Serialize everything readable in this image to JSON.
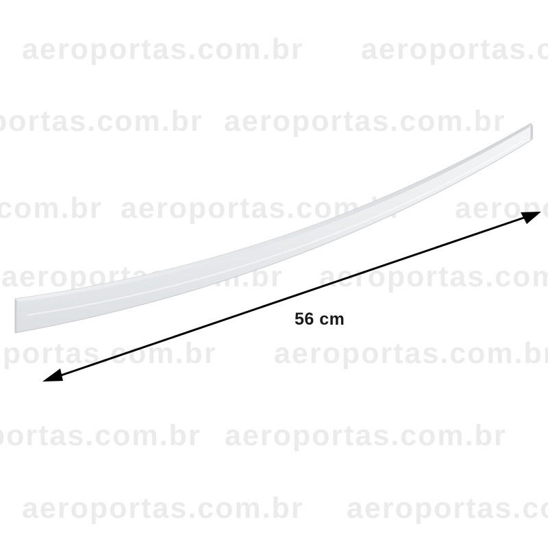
{
  "watermark": {
    "text": "aeroportas.com.br"
  },
  "dimension": {
    "label": "56 cm"
  },
  "colors": {
    "background": "#ffffff",
    "watermark": "#e8e8e8",
    "handle_light": "#f4f5f6",
    "handle_mid": "#dcdee0",
    "handle_edge": "#b9bcbf",
    "arrow": "#000000"
  },
  "icons": {
    "product": "curved-aluminum-handle",
    "measure": "double-headed-arrow"
  }
}
